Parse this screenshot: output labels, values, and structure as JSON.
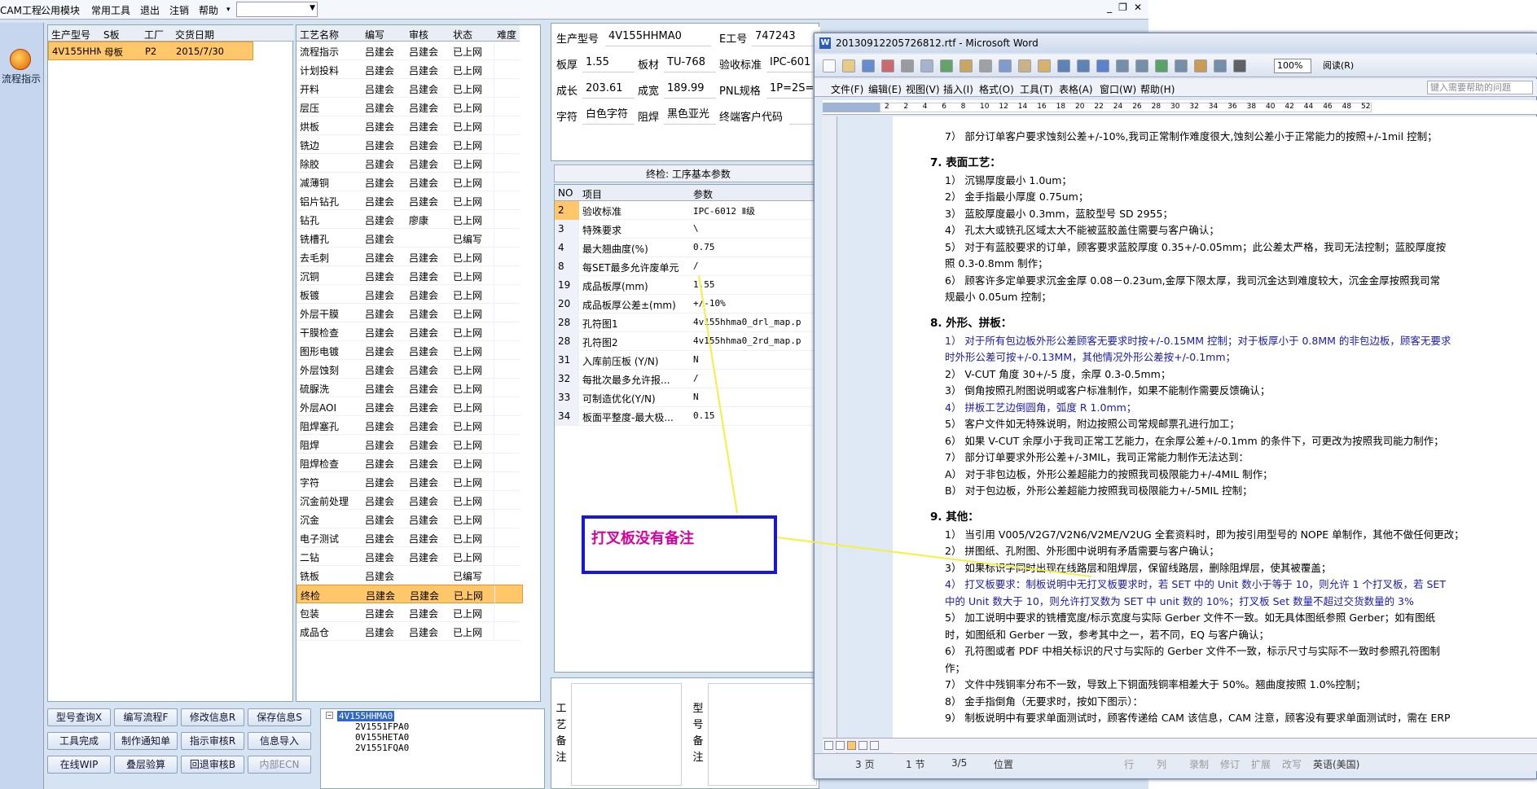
{
  "menubar": {
    "items": [
      "CAM工程",
      "公用模块",
      "常用工具",
      "退出",
      "注销",
      "帮助"
    ],
    "combo_value": ""
  },
  "leftnav": {
    "label": "流程指示",
    "icon": "process-icon"
  },
  "order_grid": {
    "headers": [
      "生产型号",
      "S板",
      "工厂",
      "交货日期"
    ],
    "rows": [
      [
        "4V155HHMA0",
        "母板",
        "P2",
        "2015/7/30"
      ]
    ]
  },
  "process_grid": {
    "headers": [
      "工艺名称",
      "编写",
      "审核",
      "状态",
      "难度"
    ],
    "rows": [
      [
        "流程指示",
        "吕建会",
        "吕建会",
        "已上网"
      ],
      [
        "计划投料",
        "吕建会",
        "吕建会",
        "已上网"
      ],
      [
        "开料",
        "吕建会",
        "吕建会",
        "已上网"
      ],
      [
        "层压",
        "吕建会",
        "吕建会",
        "已上网"
      ],
      [
        "烘板",
        "吕建会",
        "吕建会",
        "已上网"
      ],
      [
        "铣边",
        "吕建会",
        "吕建会",
        "已上网"
      ],
      [
        "除胶",
        "吕建会",
        "吕建会",
        "已上网"
      ],
      [
        "减薄铜",
        "吕建会",
        "吕建会",
        "已上网"
      ],
      [
        "铝片钻孔",
        "吕建会",
        "吕建会",
        "已上网"
      ],
      [
        "钻孔",
        "吕建会",
        "廖康",
        "已上网"
      ],
      [
        "铣槽孔",
        "吕建会",
        "",
        "已编写"
      ],
      [
        "去毛刺",
        "吕建会",
        "吕建会",
        "已上网"
      ],
      [
        "沉铜",
        "吕建会",
        "吕建会",
        "已上网"
      ],
      [
        "板镀",
        "吕建会",
        "吕建会",
        "已上网"
      ],
      [
        "外层干膜",
        "吕建会",
        "吕建会",
        "已上网"
      ],
      [
        "干膜检查",
        "吕建会",
        "吕建会",
        "已上网"
      ],
      [
        "图形电镀",
        "吕建会",
        "吕建会",
        "已上网"
      ],
      [
        "外层蚀刻",
        "吕建会",
        "吕建会",
        "已上网"
      ],
      [
        "硫脲洗",
        "吕建会",
        "吕建会",
        "已上网"
      ],
      [
        "外层AOI",
        "吕建会",
        "吕建会",
        "已上网"
      ],
      [
        "阻焊塞孔",
        "吕建会",
        "吕建会",
        "已上网"
      ],
      [
        "阻焊",
        "吕建会",
        "吕建会",
        "已上网"
      ],
      [
        "阻焊检查",
        "吕建会",
        "吕建会",
        "已上网"
      ],
      [
        "字符",
        "吕建会",
        "吕建会",
        "已上网"
      ],
      [
        "沉金前处理",
        "吕建会",
        "吕建会",
        "已上网"
      ],
      [
        "沉金",
        "吕建会",
        "吕建会",
        "已上网"
      ],
      [
        "电子测试",
        "吕建会",
        "吕建会",
        "已上网"
      ],
      [
        "二钻",
        "吕建会",
        "吕建会",
        "已上网"
      ],
      [
        "铣板",
        "吕建会",
        "",
        "已编写"
      ],
      [
        "终检",
        "吕建会",
        "吕建会",
        "已上网"
      ],
      [
        "包装",
        "吕建会",
        "吕建会",
        "已上网"
      ],
      [
        "成品仓",
        "吕建会",
        "吕建会",
        "已上网"
      ]
    ],
    "selected_row": 29
  },
  "buttons": [
    "型号查询",
    "编写流程",
    "修改信息",
    "保存信息",
    "工具完成",
    "制作通知单",
    "指示审核",
    "信息导入",
    "在线WIP",
    "叠层验算",
    "回退审核",
    "内部ECN"
  ],
  "button_keys": [
    "X",
    "F",
    "R",
    "S",
    "",
    "",
    "R",
    "",
    "",
    "",
    "B",
    ""
  ],
  "tree": {
    "items": [
      "4V155HHMA0",
      "2V1551FPA0",
      "0V155HETA0",
      "2V1551FQA0"
    ]
  },
  "info": {
    "fields": [
      {
        "label": "生产型号",
        "value": "4V155HHMA0"
      },
      {
        "label": "E工号",
        "value": "747243"
      },
      {
        "label": "板厚",
        "value": "1.55"
      },
      {
        "label": "板材",
        "value": "TU-768"
      },
      {
        "label": "验收标准",
        "value": "IPC-601"
      },
      {
        "label": "成长",
        "value": "203.61"
      },
      {
        "label": "成宽",
        "value": "189.99"
      },
      {
        "label": "PNL规格",
        "value": "1P=2S="
      },
      {
        "label": "字符",
        "value": "白色字符"
      },
      {
        "label": "阻焊",
        "value": "黑色亚光"
      },
      {
        "label": "终端客户代码",
        "value": ""
      }
    ]
  },
  "params": {
    "title": "终检: 工序基本参数",
    "headers": [
      "NO",
      "项目",
      "参数"
    ],
    "rows": [
      [
        "2",
        "验收标准",
        "IPC-6012 Ⅱ级"
      ],
      [
        "3",
        "特殊要求",
        "\\"
      ],
      [
        "4",
        "最大翘曲度(%)",
        "0.75"
      ],
      [
        "8",
        "每SET最多允许废单元",
        "/"
      ],
      [
        "19",
        "成品板厚(mm)",
        "1.55"
      ],
      [
        "20",
        "成品板厚公差±(mm)",
        "+/-10%"
      ],
      [
        "28",
        "孔符图1",
        "4v155hhma0_drl_map.p"
      ],
      [
        "28",
        "孔符图2",
        "4v155hhma0_2rd_map.p"
      ],
      [
        "31",
        "入库前压板 (Y/N)",
        "N"
      ],
      [
        "32",
        "每批次最多允许报...",
        "/"
      ],
      [
        "33",
        "可制造优化(Y/N)",
        "N"
      ],
      [
        "34",
        "板面平整度-最大极...",
        "0.15"
      ]
    ]
  },
  "remarks": {
    "left_label": "工艺备注",
    "right_label": "型号备注"
  },
  "callout": {
    "text": "打叉板没有备注"
  },
  "word": {
    "title": "20130912205726812.rtf - Microsoft Word",
    "menu": [
      "文件(F)",
      "编辑(E)",
      "视图(V)",
      "插入(I)",
      "格式(O)",
      "工具(T)",
      "表格(A)",
      "窗口(W)",
      "帮助(H)"
    ],
    "search_placeholder": "键入需要帮助的问题",
    "zoom": "100%",
    "read_button": "阅读(R)",
    "ruler_ticks": [
      "2",
      "2",
      "4",
      "6",
      "8",
      "10",
      "12",
      "14",
      "16",
      "18",
      "20",
      "22",
      "24",
      "26",
      "28",
      "30",
      "32",
      "34",
      "36",
      "38",
      "40",
      "42",
      "44",
      "46",
      "48",
      "52"
    ],
    "lines": [
      {
        "t": "7） 部分订单客户要求蚀刻公差+/-10%,我司正常制作难度很大,蚀刻公差小于正常能力的按照+/-1mil 控制；",
        "c": "n"
      },
      {
        "t": "7.   表面工艺：",
        "c": "h"
      },
      {
        "t": "1） 沉锡厚度最小 1.0um；",
        "c": "n"
      },
      {
        "t": "2） 金手指最小厚度 0.75um；",
        "c": "n"
      },
      {
        "t": "3） 蓝胶厚度最小 0.3mm，蓝胶型号 SD 2955；",
        "c": "n"
      },
      {
        "t": "4） 孔太大或铣孔区域太大不能被蓝胶盖住需要与客户确认；",
        "c": "n"
      },
      {
        "t": "5） 对于有蓝胶要求的订单，顾客要求蓝胶厚度 0.35+/-0.05mm；此公差太严格，我司无法控制；蓝胶厚度按",
        "c": "n"
      },
      {
        "t": "     照 0.3-0.8mm 制作；",
        "c": "n"
      },
      {
        "t": "6） 顾客许多定单要求沉金金厚 0.08－0.23um,金厚下限太厚，我司沉金达到难度较大，沉金金厚按照我司常",
        "c": "n"
      },
      {
        "t": "     规最小 0.05um 控制；",
        "c": "n"
      },
      {
        "t": "8.   外形、拼板：",
        "c": "h"
      },
      {
        "t": "1） 对于所有包边板外形公差顾客无要求时按+/-0.15MM 控制；对于板厚小于 0.8MM 的非包边板，顾客无要求",
        "c": "b"
      },
      {
        "t": "     时外形公差可按+/-0.13MM，其他情况外形公差按+/-0.1mm；",
        "c": "b"
      },
      {
        "t": "2） V-CUT 角度 30+/-5 度，余厚 0.3-0.5mm；",
        "c": "n"
      },
      {
        "t": "3） 倒角按照孔附图说明或客户标准制作，如果不能制作需要反馈确认；",
        "c": "n"
      },
      {
        "t": "4） 拼板工艺边倒圆角，弧度 R 1.0mm；",
        "c": "b"
      },
      {
        "t": "5） 客户文件如无特殊说明，附边按照公司常规邮票孔进行加工；",
        "c": "n"
      },
      {
        "t": "6） 如果 V-CUT 余厚小于我司正常工艺能力，在余厚公差+/-0.1mm 的条件下，可更改为按照我司能力制作；",
        "c": "n"
      },
      {
        "t": "7） 部分订单要求外形公差+/-3MIL，我司正常能力制作无法达到：",
        "c": "n"
      },
      {
        "t": "   A） 对于非包边板，外形公差超能力的按照我司极限能力+/-4MIL 制作；",
        "c": "n"
      },
      {
        "t": "   B） 对于包边板，外形公差超能力按照我司极限能力+/-5MIL 控制；",
        "c": "n"
      },
      {
        "t": "9.   其他：",
        "c": "h"
      },
      {
        "t": "1） 当引用 V005/V2G7/V2N6/V2ME/V2UG 全套资料时，即为按引用型号的 NOPE 单制作，其他不做任何更改；",
        "c": "n"
      },
      {
        "t": "2） 拼图纸、孔附图、外形图中说明有矛盾需要与客户确认；",
        "c": "n"
      },
      {
        "t": "3） 如果标识字同时出现在线路层和阻焊层，保留线路层，删除阻焊层，使其被覆盖；",
        "c": "n"
      },
      {
        "t": "4） 打叉板要求：制板说明中无打叉板要求时，若 SET 中的 Unit 数小于等于 10，则允许 1 个打叉板，若 SET",
        "c": "b"
      },
      {
        "t": "     中的 Unit 数大于 10，则允许打叉数为 SET 中 unit 数的 10%；打叉板 Set 数量不超过交货数量的 3%",
        "c": "b"
      },
      {
        "t": "5） 加工说明中要求的铣槽宽度/标示宽度与实际 Gerber 文件不一致。如无具体图纸参照 Gerber；如有图纸",
        "c": "n"
      },
      {
        "t": "     时，如图纸和 Gerber 一致，参考其中之一，若不同，EQ 与客户确认；",
        "c": "n"
      },
      {
        "t": "6） 孔符图或者 PDF 中相关标识的尺寸与实际的 Gerber 文件不一致，标示尺寸与实际不一致时参照孔符图制",
        "c": "n"
      },
      {
        "t": "     作；",
        "c": "n"
      },
      {
        "t": "7） 文件中残铜率分布不一致，导致上下铜面残铜率相差大于 50%。翘曲度按照 1.0%控制；",
        "c": "n"
      },
      {
        "t": "8） 金手指倒角（无要求时，按如下图示）：",
        "c": "n"
      },
      {
        "t": "9） 制板说明中有要求单面测试时，顾客传递给 CAM 该信息，CAM 注意，顾客没有要求单面测试时，需在 ERP",
        "c": "n"
      }
    ],
    "status": [
      "3 页",
      "1 节",
      "3/5",
      "位置",
      "行",
      "列",
      "录制",
      "修订",
      "扩展",
      "改写",
      "英语(美国)"
    ]
  },
  "colors": {
    "selection": "#ffc66a",
    "callout_border": "#1717d8",
    "callout_text": "#d800a0",
    "arrow": "#f4f040",
    "blue_text": "#1a1aa8"
  }
}
